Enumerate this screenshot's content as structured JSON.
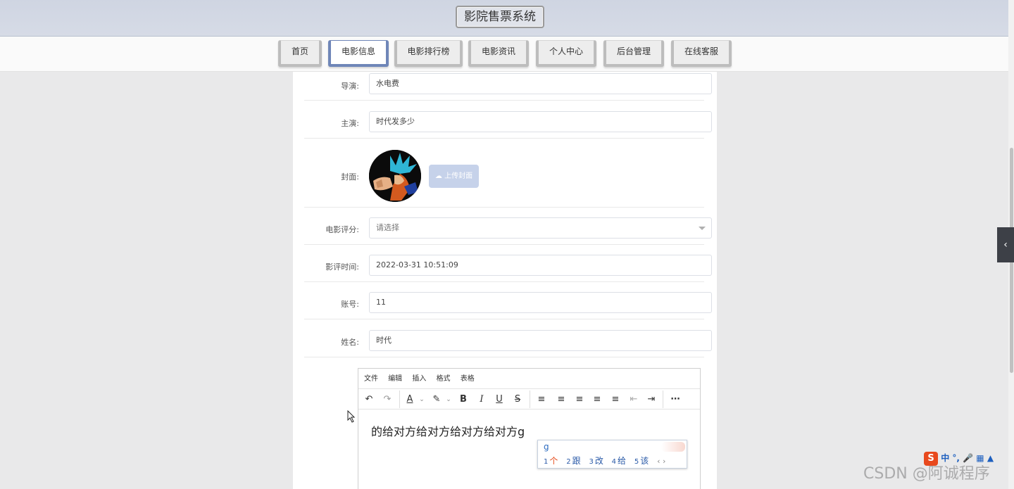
{
  "header": {
    "title": "影院售票系统"
  },
  "nav": {
    "items": [
      {
        "label": "首页"
      },
      {
        "label": "电影信息"
      },
      {
        "label": "电影排行榜"
      },
      {
        "label": "电影资讯"
      },
      {
        "label": "个人中心"
      },
      {
        "label": "后台管理"
      },
      {
        "label": "在线客服"
      }
    ],
    "active": "电影信息"
  },
  "form": {
    "director": {
      "label": "导演:",
      "value": "水电费"
    },
    "actor": {
      "label": "主演:",
      "value": "时代发多少"
    },
    "cover": {
      "label": "封面:",
      "upload_label": "上传封面"
    },
    "rating": {
      "label": "电影评分:",
      "placeholder": "请选择"
    },
    "review_time": {
      "label": "影评时间:",
      "value": "2022-03-31 10:51:09"
    },
    "account": {
      "label": "账号:",
      "value": "11"
    },
    "name": {
      "label": "姓名:",
      "value": "时代"
    }
  },
  "editor": {
    "menu": [
      "文件",
      "编辑",
      "插入",
      "格式",
      "表格"
    ],
    "content": "的给对方给对方给对方给对方g"
  },
  "ime": {
    "input": "g",
    "candidates": [
      {
        "num": "1",
        "text": "个"
      },
      {
        "num": "2",
        "text": "跟"
      },
      {
        "num": "3",
        "text": "改"
      },
      {
        "num": "4",
        "text": "给"
      },
      {
        "num": "5",
        "text": "该"
      }
    ],
    "status": "中"
  },
  "watermark": "CSDN @阿诚程序"
}
